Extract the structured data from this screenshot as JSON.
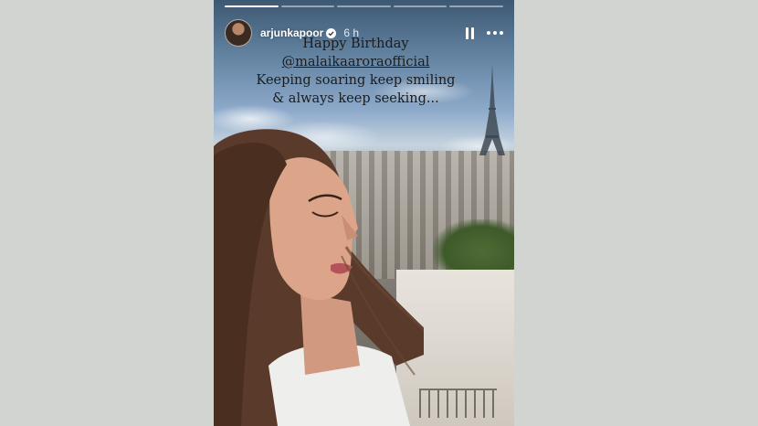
{
  "story": {
    "progress_segments": [
      {
        "status": "done"
      },
      {
        "status": "pending"
      },
      {
        "status": "pending"
      },
      {
        "status": "pending"
      },
      {
        "status": "pending"
      }
    ],
    "user": {
      "username": "arjunkapoor",
      "verified": true,
      "time": "6 h",
      "avatar_icon": "avatar"
    },
    "controls": {
      "pause_icon": "pause-icon",
      "more_icon": "more-options-icon"
    },
    "caption": {
      "line1": "Happy Birthday",
      "mention": "@malaikaaroraofficial",
      "line3": "Keeping soaring keep smiling",
      "line4": "& always keep seeking..."
    },
    "colors": {
      "page_background": "#d2d4d1",
      "caption_text": "#1c1c1c",
      "ui_text": "#ffffff"
    }
  }
}
